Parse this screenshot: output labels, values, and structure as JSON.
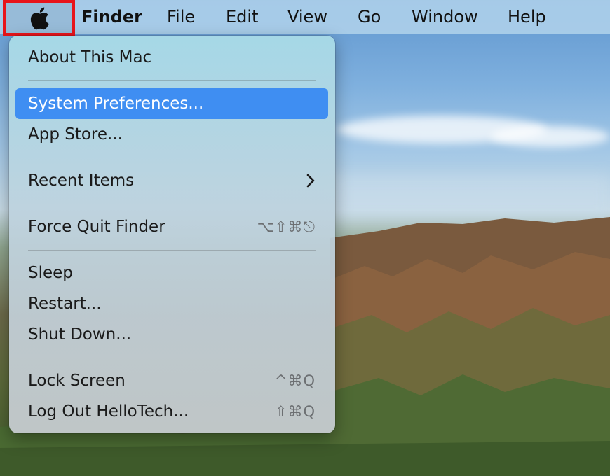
{
  "menubar": {
    "apple_icon": "apple-logo-icon",
    "app_name": "Finder",
    "items": [
      "File",
      "Edit",
      "View",
      "Go",
      "Window",
      "Help"
    ]
  },
  "apple_menu": {
    "about": "About This Mac",
    "system_preferences": "System Preferences...",
    "app_store": "App Store...",
    "recent_items": "Recent Items",
    "recent_items_icon": "chevron-right-icon",
    "force_quit": "Force Quit Finder",
    "force_quit_shortcut": "⌥⇧⌘⎋",
    "sleep": "Sleep",
    "restart": "Restart...",
    "shut_down": "Shut Down...",
    "lock_screen": "Lock Screen",
    "lock_screen_shortcut": "^⌘Q",
    "log_out": "Log Out HelloTech...",
    "log_out_shortcut": "⇧⌘Q"
  },
  "colors": {
    "highlight": "#3f8ef2",
    "annotation_box": "#e8141b"
  }
}
